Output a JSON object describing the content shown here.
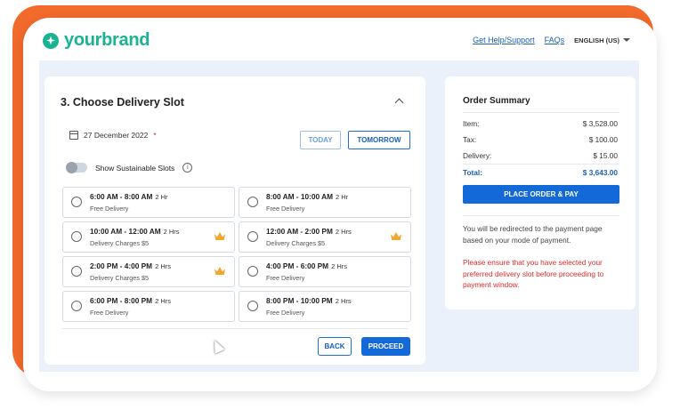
{
  "brand": {
    "name": "yourbrand",
    "color": "#19b394"
  },
  "nav": {
    "help": "Get Help/Support",
    "faqs": "FAQs",
    "language": "ENGLISH (US)"
  },
  "delivery": {
    "title": "3. Choose Delivery Slot",
    "date": "27 December 2022",
    "required_mark": "*",
    "today_label": "TODAY",
    "tomorrow_label": "TOMORROW",
    "sustainable_label": "Show Sustainable Slots",
    "slots": [
      {
        "time": "6:00 AM - 8:00 AM",
        "duration": "2 Hr",
        "note": "Free Delivery",
        "premium": false
      },
      {
        "time": "8:00 AM - 10:00 AM",
        "duration": "2 Hr",
        "note": "Free Delivery",
        "premium": false
      },
      {
        "time": "10:00 AM - 12:00 AM",
        "duration": "2 Hrs",
        "note": "Delivery Charges $5",
        "premium": true
      },
      {
        "time": "12:00 AM - 2:00 PM",
        "duration": "2 Hrs",
        "note": "Delivery Charges $5",
        "premium": true
      },
      {
        "time": "2:00 PM - 4:00 PM",
        "duration": "2 Hrs",
        "note": "Delivery Charges $5",
        "premium": true
      },
      {
        "time": "4:00 PM - 6:00 PM",
        "duration": "2 Hrs",
        "note": "Free Delivery",
        "premium": false
      },
      {
        "time": "6:00 PM - 8:00 PM",
        "duration": "2 Hrs",
        "note": "Free Delivery",
        "premium": false
      },
      {
        "time": "8:00 PM - 10:00 PM",
        "duration": "2 Hrs",
        "note": "Free Delivery",
        "premium": false
      }
    ],
    "back_label": "BACK",
    "proceed_label": "PROCEED"
  },
  "summary": {
    "title": "Order Summary",
    "item_label": "Item:",
    "item_value": "$ 3,528.00",
    "tax_label": "Tax:",
    "tax_value": "$ 100.00",
    "delivery_label": "Delivery:",
    "delivery_value": "$ 15.00",
    "total_label": "Total:",
    "total_value": "$ 3,643.00",
    "place_order_label": "PLACE ORDER & PAY",
    "note": "You will be redirected to the payment page based on your mode of payment.",
    "warning": "Please ensure that you have selected your preferred delivery slot before proceeding to payment window."
  },
  "colors": {
    "frame": "#f26a2c",
    "primary": "#1469d9",
    "warning": "#e02b2b",
    "premium": "#f0a830"
  }
}
